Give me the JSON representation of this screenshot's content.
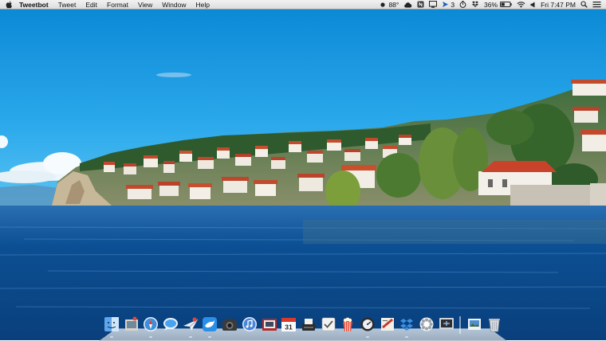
{
  "menubar": {
    "app_name": "Tweetbot",
    "menus": [
      "Tweet",
      "Edit",
      "Format",
      "View",
      "Window",
      "Help"
    ],
    "status": {
      "temperature": "88°",
      "tweetbot_count": "3",
      "battery": "36%",
      "clock": "Fri 7:47 PM"
    }
  },
  "dock": {
    "items": [
      "finder-icon",
      "preview-icon",
      "safari-icon",
      "messages-icon",
      "mail-icon",
      "tweetbot-icon",
      "screenshot-camera-icon",
      "itunes-icon",
      "photobooth-icon",
      "calendar-icon",
      "typewriter-icon",
      "tasks-icon",
      "popcorn-icon",
      "activity-monitor-icon",
      "news-icon",
      "dropbox-icon",
      "system-prefs-icon",
      "screen-sharing-icon",
      "photo-folder-icon",
      "trash-icon"
    ]
  },
  "colors": {
    "sky_top": "#0a8fd8",
    "sky_bottom": "#39b6f0",
    "lake": "#0b4b8e"
  }
}
